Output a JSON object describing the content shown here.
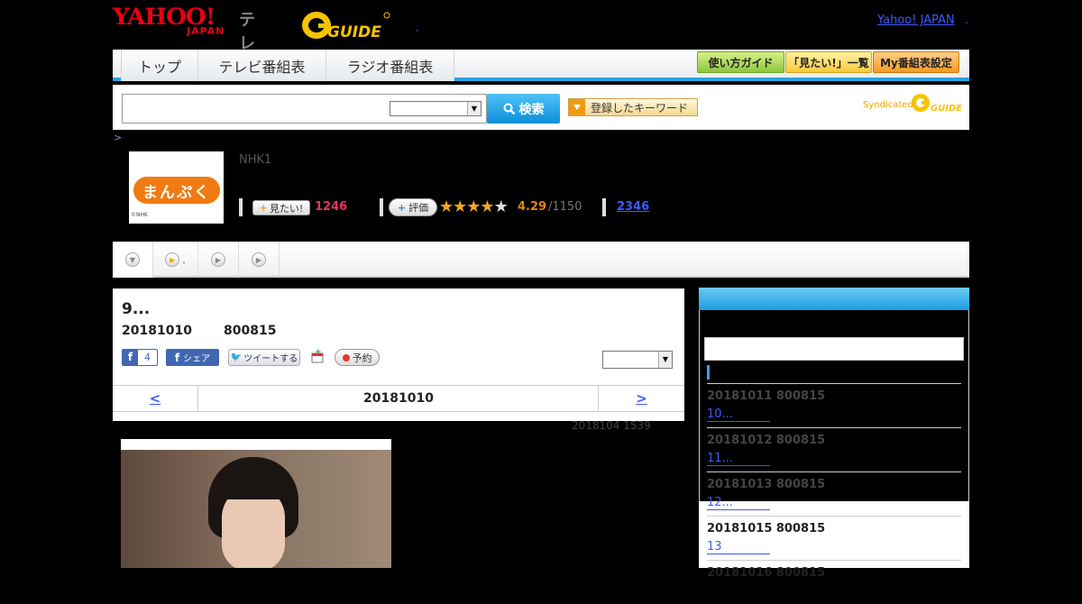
{
  "header": {
    "yahoo": "YAHOO!",
    "japan": "JAPAN",
    "tv": "テレビ",
    "guide": "GUIDE",
    "yahoo_japan_link": "Yahoo! JAPAN",
    "dot": ".",
    "blue_dot": ","
  },
  "nav": {
    "tabs": [
      "トップ",
      "テレビ番組表",
      "ラジオ番組表"
    ],
    "buttons": [
      "使い方ガイド",
      "「見たい!」一覧",
      "My番組表設定"
    ]
  },
  "search": {
    "button": "検索",
    "keyword_button": "登録したキーワード",
    "syndicated": "Syndicated",
    "g": "GUIDE"
  },
  "breadcrumb": ">",
  "program": {
    "thumb_title": "まんぷく",
    "thumb_credit": "©NHK",
    "channel": "NHK1",
    "mitai_label": "見たい!",
    "mitai_count": "1246",
    "hyoka_label": "評価",
    "rating": "4.29",
    "rating_count": "/1150",
    "review_count": "2346",
    "stars": 4.29
  },
  "subtabs": [
    {
      "label": ""
    },
    {
      "label": "."
    },
    {
      "label": ""
    },
    {
      "label": ""
    }
  ],
  "main": {
    "title": "9...",
    "date": "20181010",
    "time": "800815",
    "fb_like_count": "4",
    "fb_share": "シェア",
    "tweet": "ツイートする",
    "yoyaku": "予約",
    "pager_prev": "<",
    "pager_current": "20181010",
    "pager_next": ">",
    "updated": "2018104  1539"
  },
  "sidebar": {
    "items": [
      {
        "date": "20181011  800815",
        "link": "10..."
      },
      {
        "date": "20181012  800815",
        "link": "11..."
      },
      {
        "date": "20181013  800815",
        "link": "12..."
      },
      {
        "date": "20181015  800815",
        "link": "13"
      },
      {
        "date": "20181016  800815",
        "link": ""
      }
    ]
  },
  "colors": {
    "accent": "#29a3e0",
    "yahoo_red": "#e60012",
    "link": "#3b5bff"
  }
}
